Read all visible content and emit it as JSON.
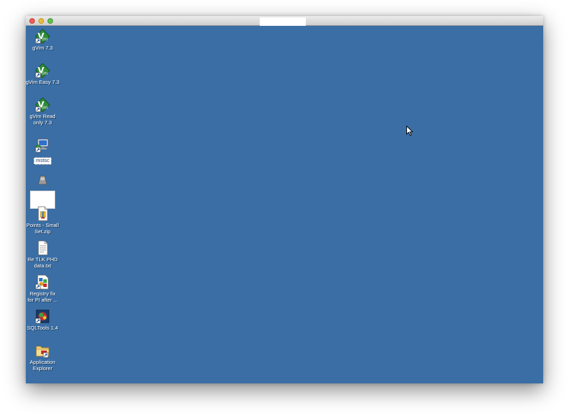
{
  "window": {
    "title": ""
  },
  "desktop": {
    "background_color": "#3a6ea5",
    "icons": [
      {
        "label": "gVim 7.3",
        "icon": "gvim-icon"
      },
      {
        "label": "gVim Easy 7.3",
        "icon": "gvim-icon"
      },
      {
        "label": "gVim Read\nonly 7.3",
        "icon": "gvim-icon"
      },
      {
        "label": "mstsc",
        "icon": "remote-desktop-icon"
      },
      {
        "label": "",
        "icon": "network-drive-icon"
      },
      {
        "label": "Points - Small\nSet.zip",
        "icon": "zip-file-icon"
      },
      {
        "label": "Re TLK PHD\ndata.txt",
        "icon": "text-file-icon"
      },
      {
        "label": "Registry fix\nfor PI after ...",
        "icon": "registry-file-icon"
      },
      {
        "label": "SQLTools 1.4",
        "icon": "sqltools-icon"
      },
      {
        "label": "Application\nExplorer",
        "icon": "folder-shortcut-icon"
      }
    ]
  }
}
